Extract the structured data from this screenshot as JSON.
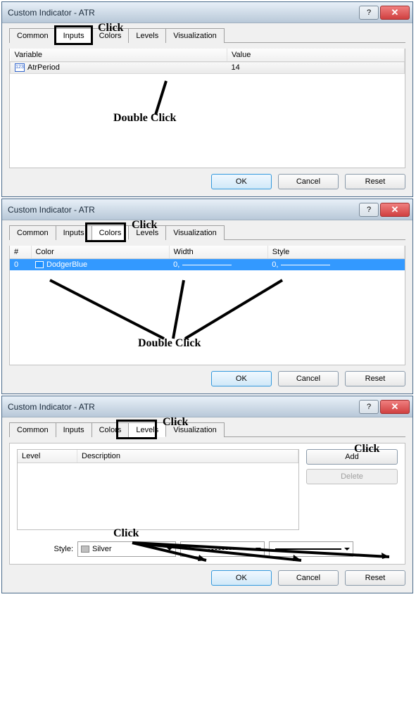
{
  "dialog_title": "Custom Indicator - ATR",
  "tabs": {
    "common": "Common",
    "inputs": "Inputs",
    "colors": "Colors",
    "levels": "Levels",
    "visualization": "Visualization"
  },
  "buttons": {
    "ok": "OK",
    "cancel": "Cancel",
    "reset": "Reset",
    "add": "Add",
    "delete": "Delete"
  },
  "inputs_panel": {
    "col_variable": "Variable",
    "col_value": "Value",
    "row_var": "AtrPeriod",
    "row_val": "14"
  },
  "colors_panel": {
    "col_idx": "#",
    "col_color": "Color",
    "col_width": "Width",
    "col_style": "Style",
    "row_idx": "0",
    "row_color": "DodgerBlue",
    "row_width": "0,",
    "row_style": "0,"
  },
  "levels_panel": {
    "col_level": "Level",
    "col_desc": "Description",
    "style_label": "Style:",
    "style_value": "Silver"
  },
  "annotations": {
    "click": "Click",
    "dblclick": "Double Click"
  }
}
